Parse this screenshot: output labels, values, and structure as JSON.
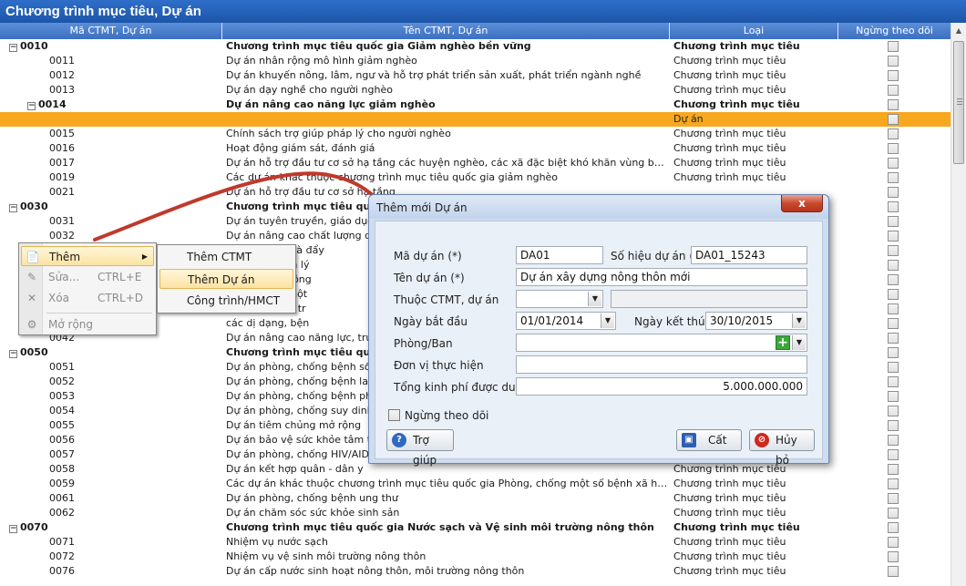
{
  "window": {
    "title": "Chương trình mục tiêu, Dự án"
  },
  "grid": {
    "columns": [
      "Mã CTMT, Dự án",
      "Tên CTMT, Dự án",
      "Loại",
      "Ngừng theo dõi"
    ],
    "rows": [
      {
        "code": "0010",
        "name": "Chương trình mục tiêu quốc gia Giảm nghèo bền vững",
        "type": "Chương trình mục tiêu",
        "bold": true,
        "expander": "minus",
        "indent": 0
      },
      {
        "code": "0011",
        "name": "Dự án nhân rộng mô hình giảm nghèo",
        "type": "Chương trình mục tiêu",
        "indent": 1
      },
      {
        "code": "0012",
        "name": "Dự án khuyến nông, lâm, ngư và hỗ trợ phát triển sản xuất, phát triển ngành nghề",
        "type": "Chương trình mục tiêu",
        "indent": 1
      },
      {
        "code": "0013",
        "name": "Dự án dạy nghề cho người nghèo",
        "type": "Chương trình mục tiêu",
        "indent": 1
      },
      {
        "code": "0014",
        "name": "Dự án nâng cao năng lực giảm nghèo",
        "type": "Chương trình mục tiêu",
        "bold": true,
        "expander": "minus",
        "indent": 1
      },
      {
        "code": "",
        "name": "",
        "type": "Dự án",
        "selected": true,
        "indent": 2
      },
      {
        "code": "0015",
        "name": "Chính sách trợ giúp pháp lý cho người nghèo",
        "type": "Chương trình mục tiêu",
        "indent": 1
      },
      {
        "code": "0016",
        "name": "Hoạt động giám sát, đánh giá",
        "type": "Chương trình mục tiêu",
        "indent": 1
      },
      {
        "code": "0017",
        "name": "Dự án hỗ trợ đầu tư cơ sở hạ tầng các huyện nghèo, các xã đặc biệt khó khăn vùng bãi ngang,...",
        "type": "Chương trình mục tiêu",
        "indent": 1
      },
      {
        "code": "0019",
        "name": "Các dự án khác thuộc chương trình mục tiêu quốc gia giảm nghèo",
        "type": "Chương trình mục tiêu",
        "indent": 1
      },
      {
        "code": "0021",
        "name": "Dự án hỗ trợ đầu tư cơ sở hạ tầng",
        "type": "",
        "indent": 1
      },
      {
        "code": "0030",
        "name": "Chương trình mục tiêu quốc gia",
        "type": "",
        "bold": true,
        "expander": "minus",
        "indent": 0
      },
      {
        "code": "0031",
        "name": "Dự án tuyên truyền, giáo dục ch",
        "type": "",
        "indent": 1
      },
      {
        "code": "0032",
        "name": "Dự án nâng cao chất lượng dịch",
        "type": "",
        "indent": 1
      },
      {
        "code": "",
        "name": "nhu cầu cần và đẩy",
        "type": "",
        "indent": 1
      },
      {
        "code": "",
        "name": "năng lực quản lý",
        "type": "",
        "indent": 1
      },
      {
        "code": "",
        "name": "chất lượng thông",
        "type": "",
        "indent": 1
      },
      {
        "code": "",
        "name": "m, mở rộng một",
        "type": "",
        "indent": 1
      },
      {
        "code": "",
        "name": "thuộc chương tr",
        "type": "",
        "indent": 1
      },
      {
        "code": "",
        "name": "các dị dạng, bện",
        "type": "",
        "indent": 1
      },
      {
        "code": "0042",
        "name": "Dự án nâng cao năng lực, truyền",
        "type": "",
        "indent": 1
      },
      {
        "code": "0050",
        "name": "Chương trình mục tiêu quốc g",
        "type": "",
        "bold": true,
        "expander": "minus",
        "indent": 0
      },
      {
        "code": "0051",
        "name": "Dự án phòng, chống bệnh sốt rét",
        "type": "",
        "indent": 1
      },
      {
        "code": "0052",
        "name": "Dự án phòng, chống bệnh lao",
        "type": "",
        "indent": 1
      },
      {
        "code": "0053",
        "name": "Dự án phòng, chống bệnh phong",
        "type": "",
        "indent": 1
      },
      {
        "code": "0054",
        "name": "Dự án phòng, chống suy dinh dư",
        "type": "",
        "indent": 1
      },
      {
        "code": "0055",
        "name": "Dự án tiêm chủng mở rộng",
        "type": "",
        "indent": 1
      },
      {
        "code": "0056",
        "name": "Dự án bảo vệ sức khỏe tâm thần",
        "type": "",
        "indent": 1
      },
      {
        "code": "0057",
        "name": "Dự án phòng, chống HIV/AIDS",
        "type": "",
        "indent": 1
      },
      {
        "code": "0058",
        "name": "Dự án kết hợp quân - dân y",
        "type": "Chương trình mục tiêu",
        "indent": 1
      },
      {
        "code": "0059",
        "name": "Các dự án khác thuộc chương trình mục tiêu quốc gia Phòng, chống một số bệnh xã hội, bệnh...",
        "type": "Chương trình mục tiêu",
        "indent": 1
      },
      {
        "code": "0061",
        "name": "Dự án phòng, chống bệnh ung thư",
        "type": "Chương trình mục tiêu",
        "indent": 1
      },
      {
        "code": "0062",
        "name": "Dự án chăm sóc sức khỏe sinh sản",
        "type": "Chương trình mục tiêu",
        "indent": 1
      },
      {
        "code": "0070",
        "name": "Chương trình mục tiêu quốc gia Nước sạch và Vệ sinh môi trường nông thôn",
        "type": "Chương trình mục tiêu",
        "bold": true,
        "expander": "minus",
        "indent": 0
      },
      {
        "code": "0071",
        "name": "Nhiệm vụ nước sạch",
        "type": "Chương trình mục tiêu",
        "indent": 1
      },
      {
        "code": "0072",
        "name": "Nhiệm vụ vệ sinh môi trường nông thôn",
        "type": "Chương trình mục tiêu",
        "indent": 1
      },
      {
        "code": "0076",
        "name": "Dự án cấp nước sinh hoạt nông thôn, môi trường nông thôn",
        "type": "Chương trình mục tiêu",
        "indent": 1
      }
    ]
  },
  "context_menu": {
    "items": [
      {
        "label": "Thêm",
        "shortcut": "",
        "icon": "add-doc-icon",
        "highlighted": true,
        "disabled": false,
        "submenu": true
      },
      {
        "label": "Sửa...",
        "shortcut": "CTRL+E",
        "icon": "edit-icon",
        "disabled": true
      },
      {
        "label": "Xóa",
        "shortcut": "CTRL+D",
        "icon": "delete-icon",
        "disabled": true
      },
      {
        "label": "Mở rộng",
        "shortcut": "",
        "icon": "expand-icon",
        "disabled": true
      }
    ],
    "submenu": [
      {
        "label": "Thêm CTMT"
      },
      {
        "label": "Thêm Dự án",
        "highlighted": true
      },
      {
        "label": "Công trình/HMCT"
      }
    ]
  },
  "dialog": {
    "title": "Thêm mới Dự án",
    "close": "x",
    "fields": {
      "ma_du_an": {
        "label": "Mã dự án (*)",
        "value": "DA01"
      },
      "so_hieu": {
        "label": "Số hiệu dự án (*)",
        "value": "DA01_15243"
      },
      "ten_du_an": {
        "label": "Tên dự án (*)",
        "value": "Dự án xây dựng nông thôn mới"
      },
      "thuoc_ctmt": {
        "label": "Thuộc CTMT, dự án",
        "value": ""
      },
      "ngay_bat_dau": {
        "label": "Ngày bắt đầu",
        "value": "01/01/2014"
      },
      "ngay_ket_thuc": {
        "label": "Ngày kết thúc",
        "value": "30/10/2015"
      },
      "phong_ban": {
        "label": "Phòng/Ban",
        "value": ""
      },
      "don_vi": {
        "label": "Đơn vị thực hiện",
        "value": ""
      },
      "tong_kinh_phi": {
        "label": "Tổng kinh phí được duyệt",
        "value": "5.000.000.000"
      }
    },
    "ngung_theo_doi": "Ngừng theo dõi",
    "buttons": {
      "help": "Trợ giúp",
      "save": "Cất",
      "cancel": "Hủy bỏ"
    }
  },
  "colors": {
    "title_bar": "#1d56a8",
    "selected_row": "#f7a81f",
    "arrow": "#c0392b"
  }
}
